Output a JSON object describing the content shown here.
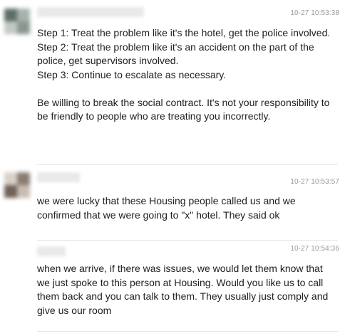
{
  "messages": [
    {
      "timestamp": "10-27 10:53:38",
      "paragraphs": [
        "Step 1: Treat the problem like it's the hotel, get the police involved.",
        "Step 2: Treat the problem like it's an accident on the part of the police, get supervisors involved.",
        "Step 3: Continue to escalate as necessary.",
        "",
        "Be willing to break the social contract. It's not your responsibility to be friendly to people who are treating you incorrectly."
      ]
    },
    {
      "timestamp": "10-27 10:53:57",
      "paragraphs": [
        "we were lucky that these Housing people called us and we confirmed that we were going to \"x\" hotel. They said ok"
      ]
    },
    {
      "timestamp": "10-27 10:54:36",
      "paragraphs": [
        "when we arrive, if there was issues, we would let them know that we just spoke to this person at Housing. Would you like us to call them back and you can talk to them. They usually just comply and give us our room"
      ]
    }
  ]
}
